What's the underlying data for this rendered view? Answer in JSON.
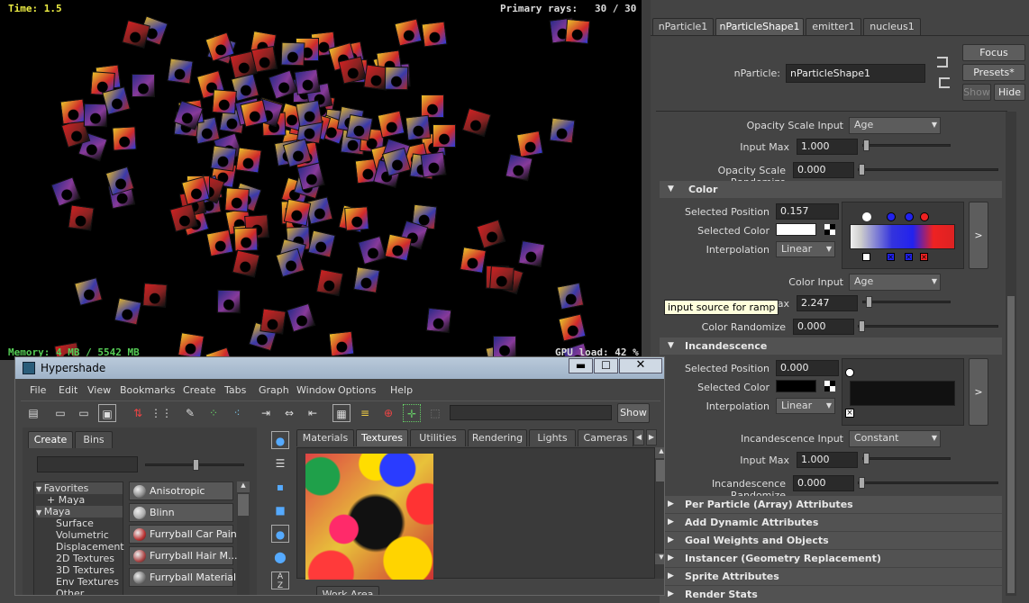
{
  "viewport": {
    "time_label": "Time: 1.5",
    "rays_label": "Primary rays:",
    "rays_value": "30 / 30",
    "memory_label": "Memory: 4 MB / 5542 MB",
    "gpu_label": "GPU load: 42 %"
  },
  "attribute_editor": {
    "tabs": [
      "nParticle1",
      "nParticleShape1",
      "emitter1",
      "nucleus1"
    ],
    "focus_label": "Focus",
    "presets_label": "Presets*",
    "show_label": "Show",
    "hide_label": "Hide",
    "node_label": "nParticle:",
    "node_value": "nParticleShape1",
    "opacity_scale_input_label": "Opacity Scale Input",
    "opacity_scale_input_value": "Age",
    "input_max_label": "Input Max",
    "opacity_input_max_value": "1.000",
    "opacity_scale_randomize_label": "Opacity Scale Randomize",
    "opacity_scale_randomize_value": "0.000",
    "color_section": "Color",
    "selected_position_label": "Selected Position",
    "color_selected_position": "0.157",
    "selected_color_label": "Selected Color",
    "interpolation_label": "Interpolation",
    "color_interpolation": "Linear",
    "ramp_button": ">",
    "color_input_label": "Color Input",
    "color_input_value": "Age",
    "color_input_max_value": "2.247",
    "tooltip": "input source for ramp",
    "color_randomize_label": "Color Randomize",
    "color_randomize_value": "0.000",
    "incandescence_section": "Incandescence",
    "inc_selected_position": "0.000",
    "inc_interpolation": "Linear",
    "incandescence_input_label": "Incandescence Input",
    "incandescence_input_value": "Constant",
    "inc_input_max_value": "1.000",
    "incandescence_randomize_label": "Incandescence Randomize",
    "incandescence_randomize_value": "0.000",
    "collapsed_sections": [
      "Per Particle (Array) Attributes",
      "Add Dynamic Attributes",
      "Goal Weights and Objects",
      "Instancer (Geometry Replacement)",
      "Sprite Attributes",
      "Render Stats"
    ],
    "colors": {
      "ramp_white": "#ffffff",
      "ramp_blue": "#2222ee",
      "ramp_red": "#ee2222"
    }
  },
  "hypershade": {
    "title": "Hypershade",
    "menu": [
      "File",
      "Edit",
      "View",
      "Bookmarks",
      "Create",
      "Tabs",
      "Graph",
      "Window",
      "Options",
      "Help"
    ],
    "show_label": "Show",
    "left_tabs": [
      "Create",
      "Bins"
    ],
    "tree": {
      "favorites": "Favorites",
      "maya_fav": "Maya",
      "maya": "Maya",
      "items": [
        "Surface",
        "Volumetric",
        "Displacement",
        "2D Textures",
        "3D Textures",
        "Env Textures",
        "Other Textures"
      ]
    },
    "materials": [
      "Anisotropic",
      "Blinn",
      "Furryball Car Paint",
      "Furryball Hair M...",
      "Furryball Material"
    ],
    "tabs": [
      "Materials",
      "Textures",
      "Utilities",
      "Rendering",
      "Lights",
      "Cameras"
    ],
    "active_tab": "Textures",
    "work_area_label": "Work Area"
  }
}
